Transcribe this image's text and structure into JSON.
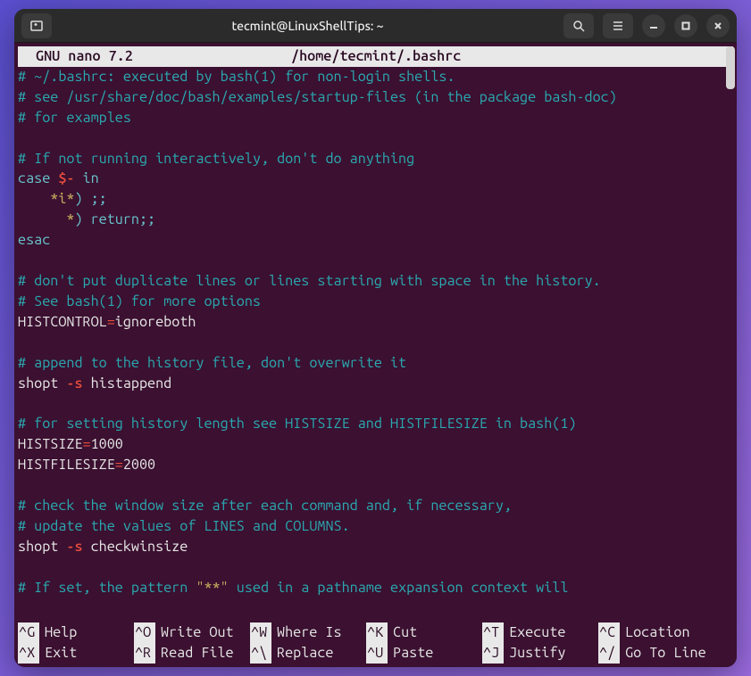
{
  "titlebar": {
    "title": "tecmint@LinuxShellTips: ~"
  },
  "nano": {
    "app": "GNU nano 7.2",
    "filepath": "/home/tecmint/.bashrc"
  },
  "lines": [
    {
      "t": "comment",
      "text": "# ~/.bashrc: executed by bash(1) for non-login shells."
    },
    {
      "t": "comment",
      "text": "# see /usr/share/doc/bash/examples/startup-files (in the package bash-doc)"
    },
    {
      "t": "comment",
      "text": "# for examples"
    },
    {
      "t": "blank",
      "text": ""
    },
    {
      "t": "comment",
      "text": "# If not running interactively, don't do anything"
    },
    {
      "t": "case",
      "pre": "case ",
      "var": "$-",
      "post": " in"
    },
    {
      "t": "casebranch",
      "indent": "    ",
      "pat": "*i*",
      "rest": ") ;;"
    },
    {
      "t": "casebranch",
      "indent": "      ",
      "pat": "*",
      "rest": ") return;;"
    },
    {
      "t": "keyword",
      "text": "esac"
    },
    {
      "t": "blank",
      "text": ""
    },
    {
      "t": "comment",
      "text": "# don't put duplicate lines or lines starting with space in the history."
    },
    {
      "t": "comment",
      "text": "# See bash(1) for more options"
    },
    {
      "t": "assign",
      "name": "HISTCONTROL",
      "eq": "=",
      "val": "ignoreboth"
    },
    {
      "t": "blank",
      "text": ""
    },
    {
      "t": "comment",
      "text": "# append to the history file, don't overwrite it"
    },
    {
      "t": "shopt",
      "cmd": "shopt ",
      "flag": "-s",
      "arg": " histappend"
    },
    {
      "t": "blank",
      "text": ""
    },
    {
      "t": "comment",
      "text": "# for setting history length see HISTSIZE and HISTFILESIZE in bash(1)"
    },
    {
      "t": "assign",
      "name": "HISTSIZE",
      "eq": "=",
      "val": "1000"
    },
    {
      "t": "assign",
      "name": "HISTFILESIZE",
      "eq": "=",
      "val": "2000"
    },
    {
      "t": "blank",
      "text": ""
    },
    {
      "t": "comment",
      "text": "# check the window size after each command and, if necessary,"
    },
    {
      "t": "comment",
      "text": "# update the values of LINES and COLUMNS."
    },
    {
      "t": "shopt",
      "cmd": "shopt ",
      "flag": "-s",
      "arg": " checkwinsize"
    },
    {
      "t": "blank",
      "text": ""
    },
    {
      "t": "commentstr",
      "pre": "# If set, the pattern ",
      "str": "\"**\"",
      "post": " used in a pathname expansion context will"
    }
  ],
  "shortcuts": {
    "row1": [
      {
        "key": "^G",
        "label": "Help"
      },
      {
        "key": "^O",
        "label": "Write Out"
      },
      {
        "key": "^W",
        "label": "Where Is"
      },
      {
        "key": "^K",
        "label": "Cut"
      },
      {
        "key": "^T",
        "label": "Execute"
      },
      {
        "key": "^C",
        "label": "Location"
      }
    ],
    "row2": [
      {
        "key": "^X",
        "label": "Exit"
      },
      {
        "key": "^R",
        "label": "Read File"
      },
      {
        "key": "^\\",
        "label": "Replace"
      },
      {
        "key": "^U",
        "label": "Paste"
      },
      {
        "key": "^J",
        "label": "Justify"
      },
      {
        "key": "^/",
        "label": "Go To Line"
      }
    ]
  }
}
